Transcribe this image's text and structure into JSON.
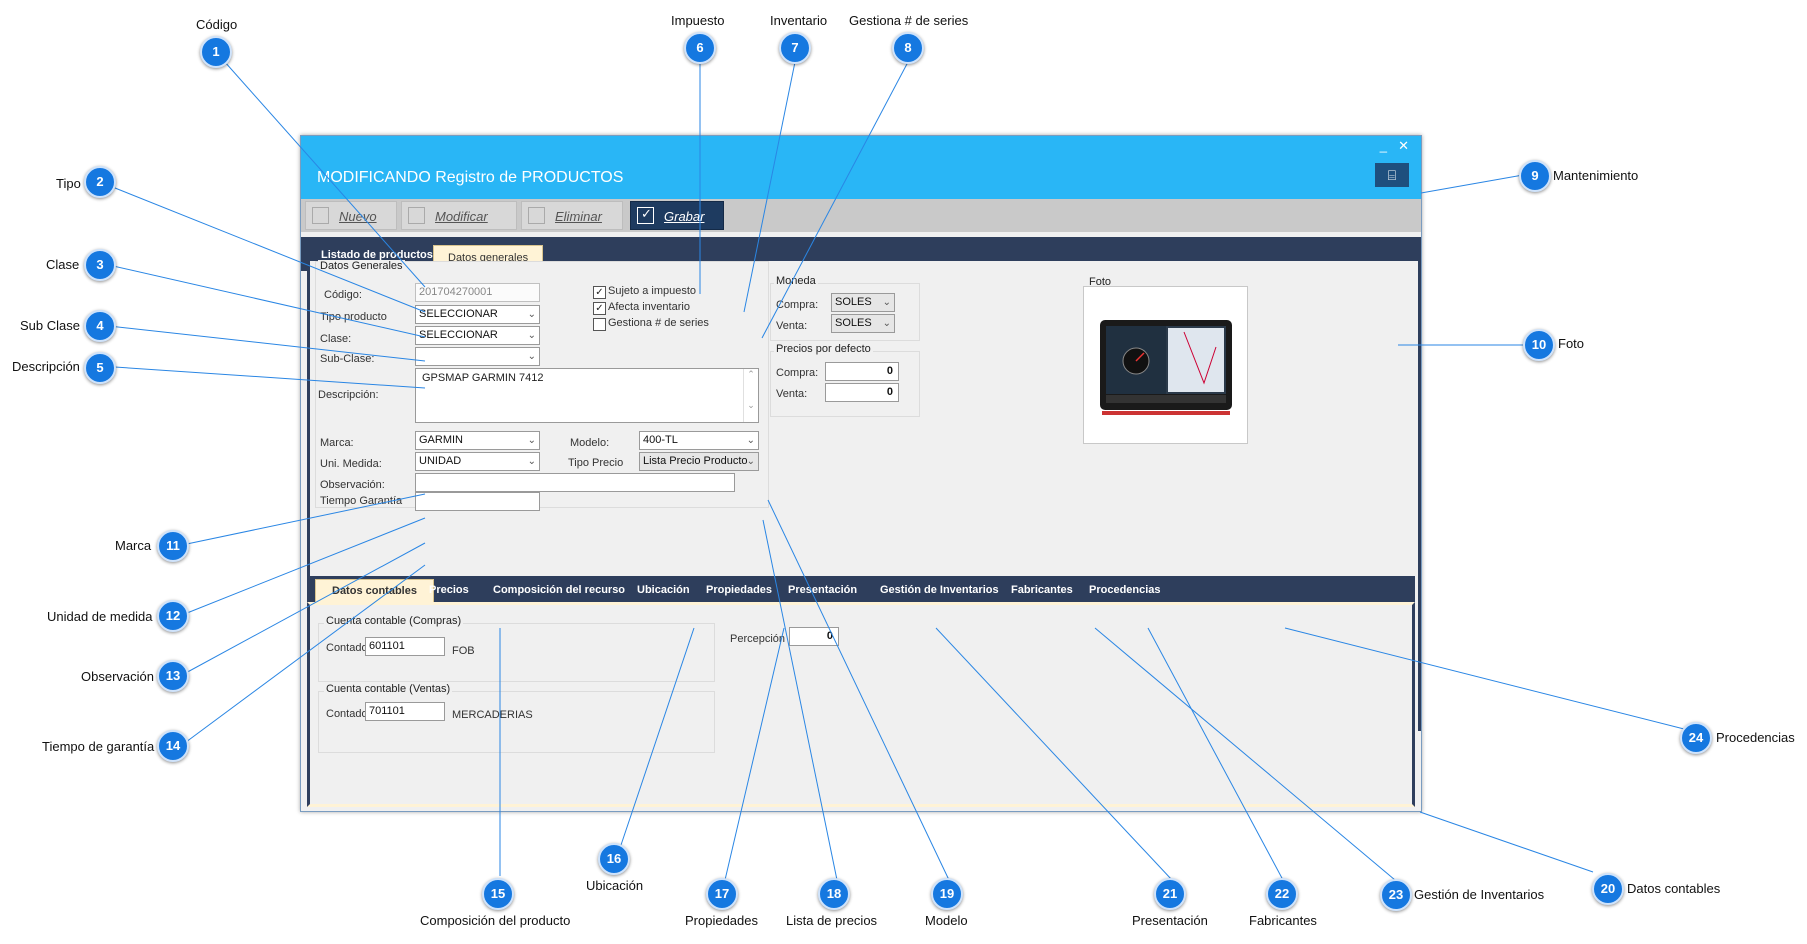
{
  "window": {
    "title": "MODIFICANDO Registro de PRODUCTOS",
    "minimize": "_",
    "close": "✕",
    "maintenance_icon": "⌸"
  },
  "toolbar": {
    "nuevo": "Nuevo",
    "modificar": "Modificar",
    "eliminar": "Eliminar",
    "grabar": "Grabar"
  },
  "top_tabs": [
    "Listado de productos",
    "Datos generales"
  ],
  "datos_generales": {
    "group_title": "Datos Generales",
    "codigo_label": "Código:",
    "codigo_value": "201704270001",
    "tipo_label": "Tipo producto",
    "tipo_value": "SELECCIONAR",
    "clase_label": "Clase:",
    "clase_value": "SELECCIONAR",
    "subclase_label": "Sub-Clase:",
    "subclase_value": "",
    "descripcion_label": "Descripción:",
    "descripcion_value": "GPSMAP GARMIN 7412",
    "marca_label": "Marca:",
    "marca_value": "GARMIN",
    "unidad_label": "Uni. Medida:",
    "unidad_value": "UNIDAD",
    "observacion_label": "Observación:",
    "observacion_value": "",
    "garantia_label": "Tiempo Garantía",
    "garantia_value": "",
    "modelo_label": "Modelo:",
    "modelo_value": "400-TL",
    "tipo_precio_label": "Tipo Precio",
    "tipo_precio_value": "Lista Precio Producto"
  },
  "checks": {
    "impuesto": "Sujeto a impuesto",
    "inventario": "Afecta  inventario",
    "series": "Gestiona # de series"
  },
  "moneda": {
    "title": "Moneda",
    "compra_label": "Compra:",
    "compra_value": "SOLES",
    "venta_label": "Venta:",
    "venta_value": "SOLES"
  },
  "precios": {
    "title": "Precios por defecto",
    "compra_label": "Compra:",
    "compra_value": "0",
    "venta_label": "Venta:",
    "venta_value": "0"
  },
  "foto": {
    "title": "Foto"
  },
  "bottom_tabs": [
    "Datos contables",
    "Precios",
    "Composición del recurso",
    "Ubicación",
    "Propiedades",
    "Presentación",
    "Gestión de Inventarios",
    "Fabricantes",
    "Procedencias"
  ],
  "contable": {
    "compras_title": "Cuenta contable (Compras)",
    "compras_label": "Contado:",
    "compras_value": "601101",
    "compras_desc": "FOB",
    "ventas_title": "Cuenta contable (Ventas)",
    "ventas_label": "Contado:",
    "ventas_value": "701101",
    "ventas_desc": "MERCADERIAS",
    "percepcion_label": "Percepción",
    "percepcion_value": "0"
  },
  "callouts": [
    {
      "n": "1",
      "label": "Código"
    },
    {
      "n": "2",
      "label": "Tipo"
    },
    {
      "n": "3",
      "label": "Clase"
    },
    {
      "n": "4",
      "label": "Sub Clase"
    },
    {
      "n": "5",
      "label": "Descripción"
    },
    {
      "n": "6",
      "label": "Impuesto"
    },
    {
      "n": "7",
      "label": "Inventario"
    },
    {
      "n": "8",
      "label": "Gestiona # de series"
    },
    {
      "n": "9",
      "label": "Mantenimiento"
    },
    {
      "n": "10",
      "label": "Foto"
    },
    {
      "n": "11",
      "label": "Marca"
    },
    {
      "n": "12",
      "label": "Unidad de medida"
    },
    {
      "n": "13",
      "label": "Observación"
    },
    {
      "n": "14",
      "label": "Tiempo de garantía"
    },
    {
      "n": "15",
      "label": "Composición del producto"
    },
    {
      "n": "16",
      "label": "Ubicación"
    },
    {
      "n": "17",
      "label": "Propiedades"
    },
    {
      "n": "18",
      "label": "Lista de precios"
    },
    {
      "n": "19",
      "label": "Modelo"
    },
    {
      "n": "20",
      "label": "Datos contables"
    },
    {
      "n": "21",
      "label": "Presentación"
    },
    {
      "n": "22",
      "label": "Fabricantes"
    },
    {
      "n": "23",
      "label": "Gestión de Inventarios"
    },
    {
      "n": "24",
      "label": "Procedencias"
    }
  ],
  "colors": {
    "title_bar": "#29b6f6",
    "dark_navy": "#2e3e5c",
    "badge": "#1578e0",
    "leader": "#2a86e4"
  }
}
